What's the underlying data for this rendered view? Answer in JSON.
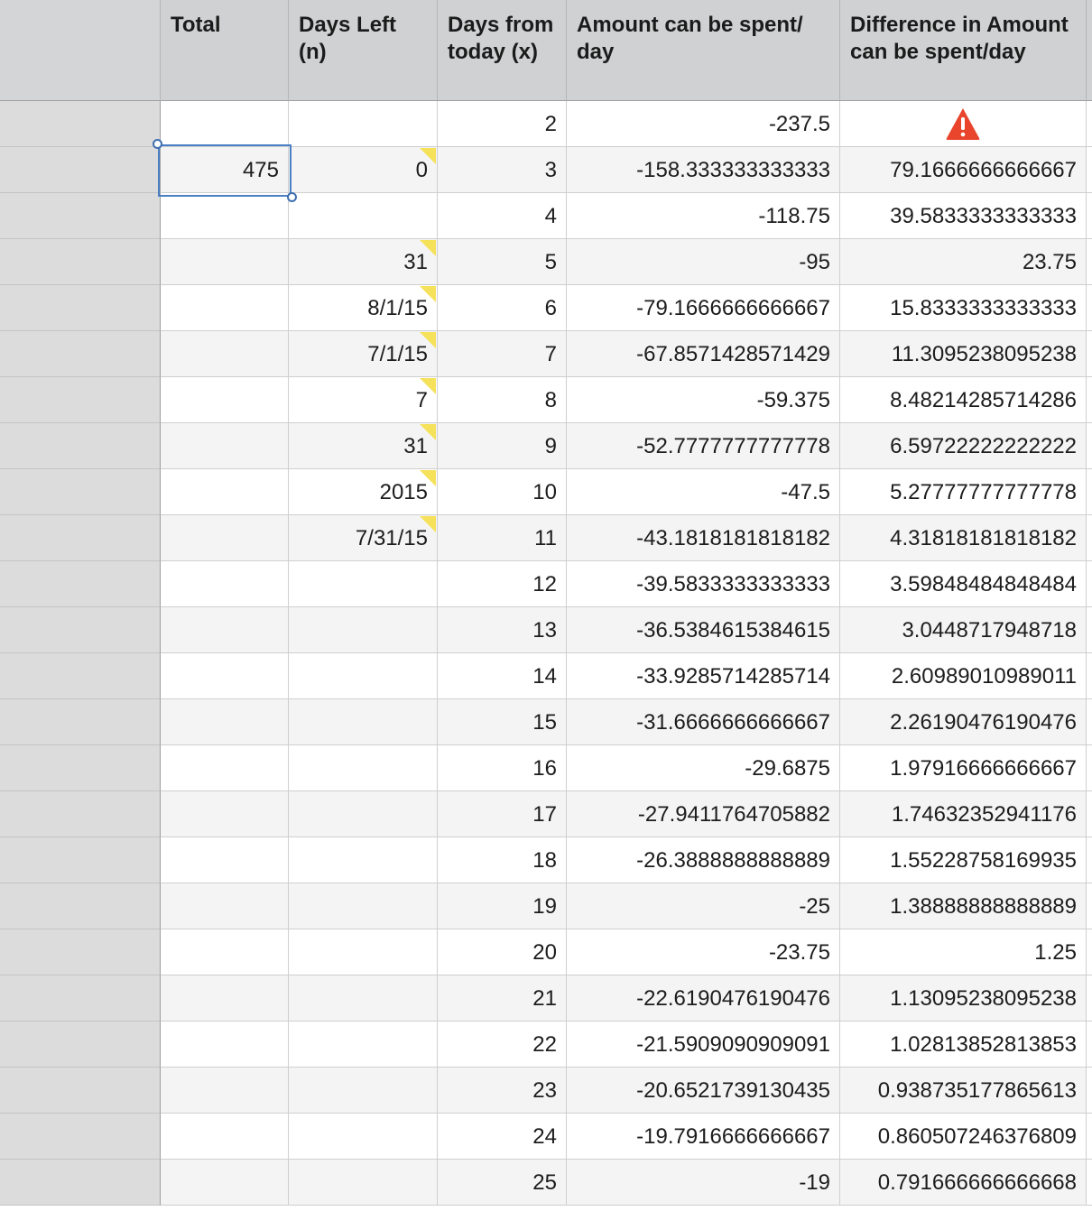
{
  "headers": [
    "",
    "Total",
    "Days Left (n)",
    "Days from today (x)",
    "Amount can be spent/ day",
    "Difference in Amount can be spent/day"
  ],
  "rows": [
    {
      "total": "",
      "days_left": "",
      "days_left_comment": false,
      "x": "2",
      "amount": "-237.5",
      "diff": "",
      "diff_warning": true
    },
    {
      "total": "475",
      "days_left": "0",
      "days_left_comment": true,
      "x": "3",
      "amount": "-158.333333333333",
      "diff": "79.1666666666667"
    },
    {
      "total": "",
      "days_left": "",
      "days_left_comment": false,
      "x": "4",
      "amount": "-118.75",
      "diff": "39.5833333333333"
    },
    {
      "total": "",
      "days_left": "31",
      "days_left_comment": true,
      "x": "5",
      "amount": "-95",
      "diff": "23.75"
    },
    {
      "total": "",
      "days_left": "8/1/15",
      "days_left_comment": true,
      "x": "6",
      "amount": "-79.1666666666667",
      "diff": "15.8333333333333"
    },
    {
      "total": "",
      "days_left": "7/1/15",
      "days_left_comment": true,
      "x": "7",
      "amount": "-67.8571428571429",
      "diff": "11.3095238095238"
    },
    {
      "total": "",
      "days_left": "7",
      "days_left_comment": true,
      "x": "8",
      "amount": "-59.375",
      "diff": "8.48214285714286"
    },
    {
      "total": "",
      "days_left": "31",
      "days_left_comment": true,
      "x": "9",
      "amount": "-52.7777777777778",
      "diff": "6.59722222222222"
    },
    {
      "total": "",
      "days_left": "2015",
      "days_left_comment": true,
      "x": "10",
      "amount": "-47.5",
      "diff": "5.27777777777778"
    },
    {
      "total": "",
      "days_left": "7/31/15",
      "days_left_comment": true,
      "x": "11",
      "amount": "-43.1818181818182",
      "diff": "4.31818181818182"
    },
    {
      "total": "",
      "days_left": "",
      "days_left_comment": false,
      "x": "12",
      "amount": "-39.5833333333333",
      "diff": "3.59848484848484"
    },
    {
      "total": "",
      "days_left": "",
      "days_left_comment": false,
      "x": "13",
      "amount": "-36.5384615384615",
      "diff": "3.0448717948718"
    },
    {
      "total": "",
      "days_left": "",
      "days_left_comment": false,
      "x": "14",
      "amount": "-33.9285714285714",
      "diff": "2.60989010989011"
    },
    {
      "total": "",
      "days_left": "",
      "days_left_comment": false,
      "x": "15",
      "amount": "-31.6666666666667",
      "diff": "2.26190476190476"
    },
    {
      "total": "",
      "days_left": "",
      "days_left_comment": false,
      "x": "16",
      "amount": "-29.6875",
      "diff": "1.97916666666667"
    },
    {
      "total": "",
      "days_left": "",
      "days_left_comment": false,
      "x": "17",
      "amount": "-27.9411764705882",
      "diff": "1.74632352941176"
    },
    {
      "total": "",
      "days_left": "",
      "days_left_comment": false,
      "x": "18",
      "amount": "-26.3888888888889",
      "diff": "1.55228758169935"
    },
    {
      "total": "",
      "days_left": "",
      "days_left_comment": false,
      "x": "19",
      "amount": "-25",
      "diff": "1.38888888888889"
    },
    {
      "total": "",
      "days_left": "",
      "days_left_comment": false,
      "x": "20",
      "amount": "-23.75",
      "diff": "1.25"
    },
    {
      "total": "",
      "days_left": "",
      "days_left_comment": false,
      "x": "21",
      "amount": "-22.6190476190476",
      "diff": "1.13095238095238"
    },
    {
      "total": "",
      "days_left": "",
      "days_left_comment": false,
      "x": "22",
      "amount": "-21.5909090909091",
      "diff": "1.02813852813853"
    },
    {
      "total": "",
      "days_left": "",
      "days_left_comment": false,
      "x": "23",
      "amount": "-20.6521739130435",
      "diff": "0.938735177865613"
    },
    {
      "total": "",
      "days_left": "",
      "days_left_comment": false,
      "x": "24",
      "amount": "-19.7916666666667",
      "diff": "0.860507246376809"
    },
    {
      "total": "",
      "days_left": "",
      "days_left_comment": false,
      "x": "25",
      "amount": "-19",
      "diff": "0.791666666666668"
    }
  ],
  "colors": {
    "header_bg": "#cfd1d2",
    "row_header_bg": "#dcdcdc",
    "alt_row_bg": "#f4f4f4",
    "selection": "#4a7fc4",
    "comment_marker": "#f5e15a",
    "warning": "#e8452c"
  },
  "icons": {
    "warning": "warning-icon",
    "comment": "comment-indicator"
  }
}
